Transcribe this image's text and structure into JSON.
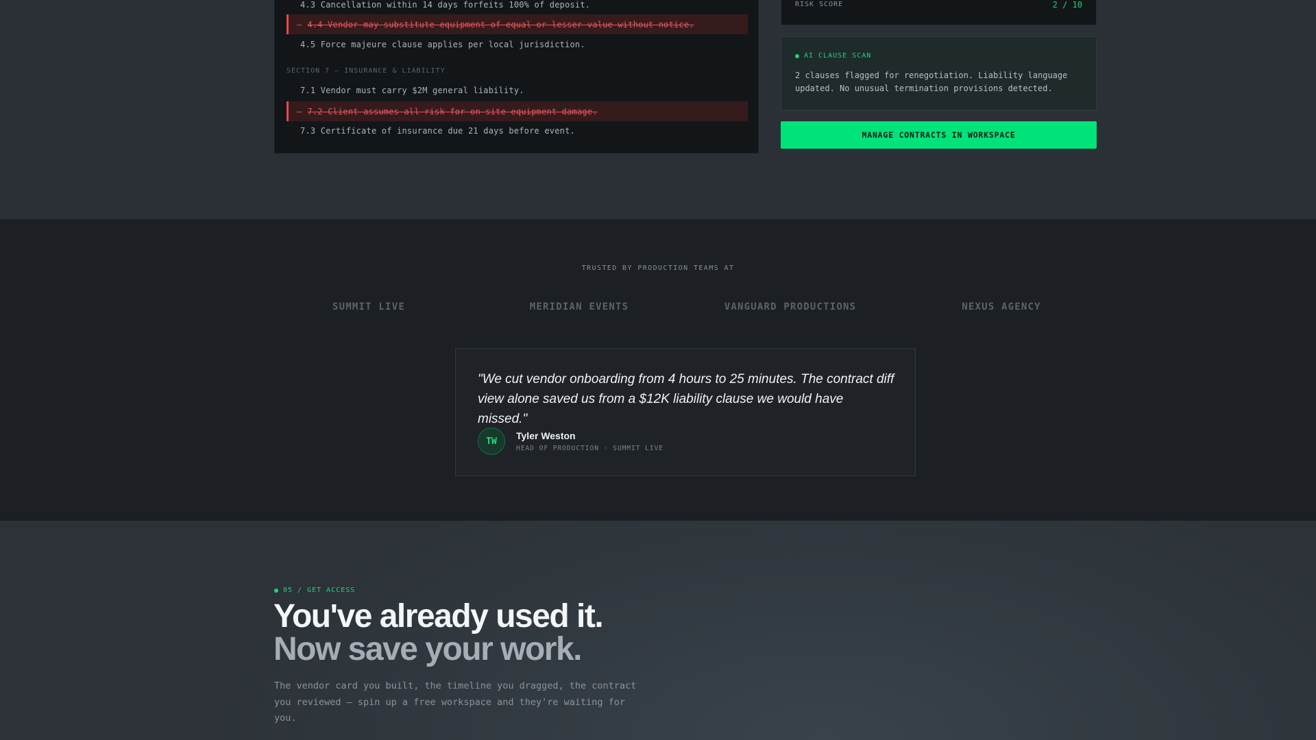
{
  "contract": {
    "clauses": [
      {
        "id": "c43",
        "text": "4.3 Cancellation within 14 days forfeits 100% of deposit.",
        "removed": false
      },
      {
        "id": "c44",
        "text": "4.4 Vendor may substitute equipment of equal or lesser value without notice.",
        "removed": true
      },
      {
        "id": "c45",
        "text": "4.5 Force majeure clause applies per local jurisdiction.",
        "removed": false
      },
      {
        "id": "c71",
        "text": "7.1 Vendor must carry $2M general liability.",
        "removed": false
      },
      {
        "id": "c72",
        "text": "7.2 Client assumes all risk for on-site equipment damage.",
        "removed": true
      },
      {
        "id": "c73",
        "text": "7.3 Certificate of insurance due 21 days before event.",
        "removed": false
      }
    ],
    "section7_label": "SECTION 7 — INSURANCE & LIABILITY",
    "removed_marker": "—"
  },
  "risk": {
    "label": "RISK SCORE",
    "value": "2 / 10"
  },
  "ai_scan": {
    "title": "AI CLAUSE SCAN",
    "body": "2 clauses flagged for renegotiation. Liability language updated. No unusual termination provisions detected."
  },
  "cta": {
    "label": "MANAGE CONTRACTS IN WORKSPACE"
  },
  "trust": {
    "title": "TRUSTED BY PRODUCTION TEAMS AT",
    "logos": [
      "SUMMIT LIVE",
      "MERIDIAN EVENTS",
      "VANGUARD PRODUCTIONS",
      "NEXUS AGENCY"
    ]
  },
  "testimonial": {
    "quote": "\"We cut vendor onboarding from 4 hours to 25 minutes. The contract diff view alone saved us from a $12K liability clause we would have missed.\"",
    "initials": "TW",
    "name": "Tyler Weston",
    "role": "HEAD OF PRODUCTION · SUMMIT LIVE"
  },
  "access": {
    "eyebrow": "05 / GET ACCESS",
    "headline_1": "You've already used it.",
    "headline_2": "Now save your work.",
    "sub": "The vendor card you built, the timeline you dragged, the contract you reviewed — spin up a free workspace and they're waiting for you."
  },
  "colors": {
    "accent": "#00e27a",
    "removed_red": "#e8484d"
  }
}
